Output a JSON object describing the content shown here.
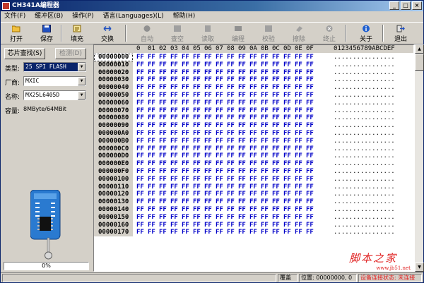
{
  "window": {
    "title": "CH341A编程器",
    "minimize_glyph": "_",
    "maximize_glyph": "□",
    "close_glyph": "×"
  },
  "menu": [
    "文件(F)",
    "缓冲区(B)",
    "操作(P)",
    "语言(Languages)(L)",
    "帮助(H)"
  ],
  "toolbar": [
    {
      "label": "打开",
      "icon": "open-folder-icon",
      "enabled": true
    },
    {
      "label": "保存",
      "icon": "save-disk-icon",
      "enabled": true
    },
    {
      "label": "填充",
      "icon": "fill-icon",
      "enabled": true
    },
    {
      "label": "交换",
      "icon": "swap-arrows-icon",
      "enabled": true
    },
    {
      "label": "自动",
      "icon": "auto-icon",
      "enabled": false
    },
    {
      "label": "查空",
      "icon": "blank-check-icon",
      "enabled": false
    },
    {
      "label": "读取",
      "icon": "read-icon",
      "enabled": false
    },
    {
      "label": "编程",
      "icon": "program-icon",
      "enabled": false
    },
    {
      "label": "校验",
      "icon": "verify-icon",
      "enabled": false
    },
    {
      "label": "擦除",
      "icon": "erase-icon",
      "enabled": false
    },
    {
      "label": "终止",
      "icon": "stop-icon",
      "enabled": false
    },
    {
      "label": "关于",
      "icon": "info-icon",
      "enabled": true
    },
    {
      "label": "退出",
      "icon": "exit-icon",
      "enabled": true
    }
  ],
  "left": {
    "detect_button": "芯片查找(S)",
    "test_button": "检测(D)",
    "type_label": "类型:",
    "type_value": "25 SPI FLASH",
    "vendor_label": "厂商:",
    "vendor_value": "MXIC",
    "name_label": "名称:",
    "name_value": "MX25L6405D",
    "capacity_label": "容量:",
    "capacity_value": "8MByte/64MBit",
    "progress_text": "0%",
    "progress": 0
  },
  "hex": {
    "header_bytes": [
      "0",
      "01",
      "02",
      "03",
      "04",
      "05",
      "06",
      "07",
      "08",
      "09",
      "0A",
      "0B",
      "0C",
      "0D",
      "0E",
      "0F"
    ],
    "header_ascii": "0123456789ABCDEF",
    "fill_byte": "FF",
    "ascii_row": "................",
    "addresses": [
      "00000000",
      "00000010",
      "00000020",
      "00000030",
      "00000040",
      "00000050",
      "00000060",
      "00000070",
      "00000080",
      "00000090",
      "000000A0",
      "000000B0",
      "000000C0",
      "000000D0",
      "000000E0",
      "000000F0",
      "00000100",
      "00000110",
      "00000120",
      "00000130",
      "00000140",
      "00000150",
      "00000160",
      "00000170"
    ]
  },
  "status": {
    "mode": "覆盖",
    "position_label": "位置:",
    "position_value": "00000000, 0",
    "device_state_label": "设备连接状态:",
    "device_state_value": "未连接"
  },
  "watermark": {
    "brand": "脚本之家",
    "url": "www.jb51.net"
  },
  "colors": {
    "title_bar": "#0a246a",
    "hex_bytes": "#0000c8",
    "selection": "#0a246a",
    "status_warn": "#e02020"
  }
}
